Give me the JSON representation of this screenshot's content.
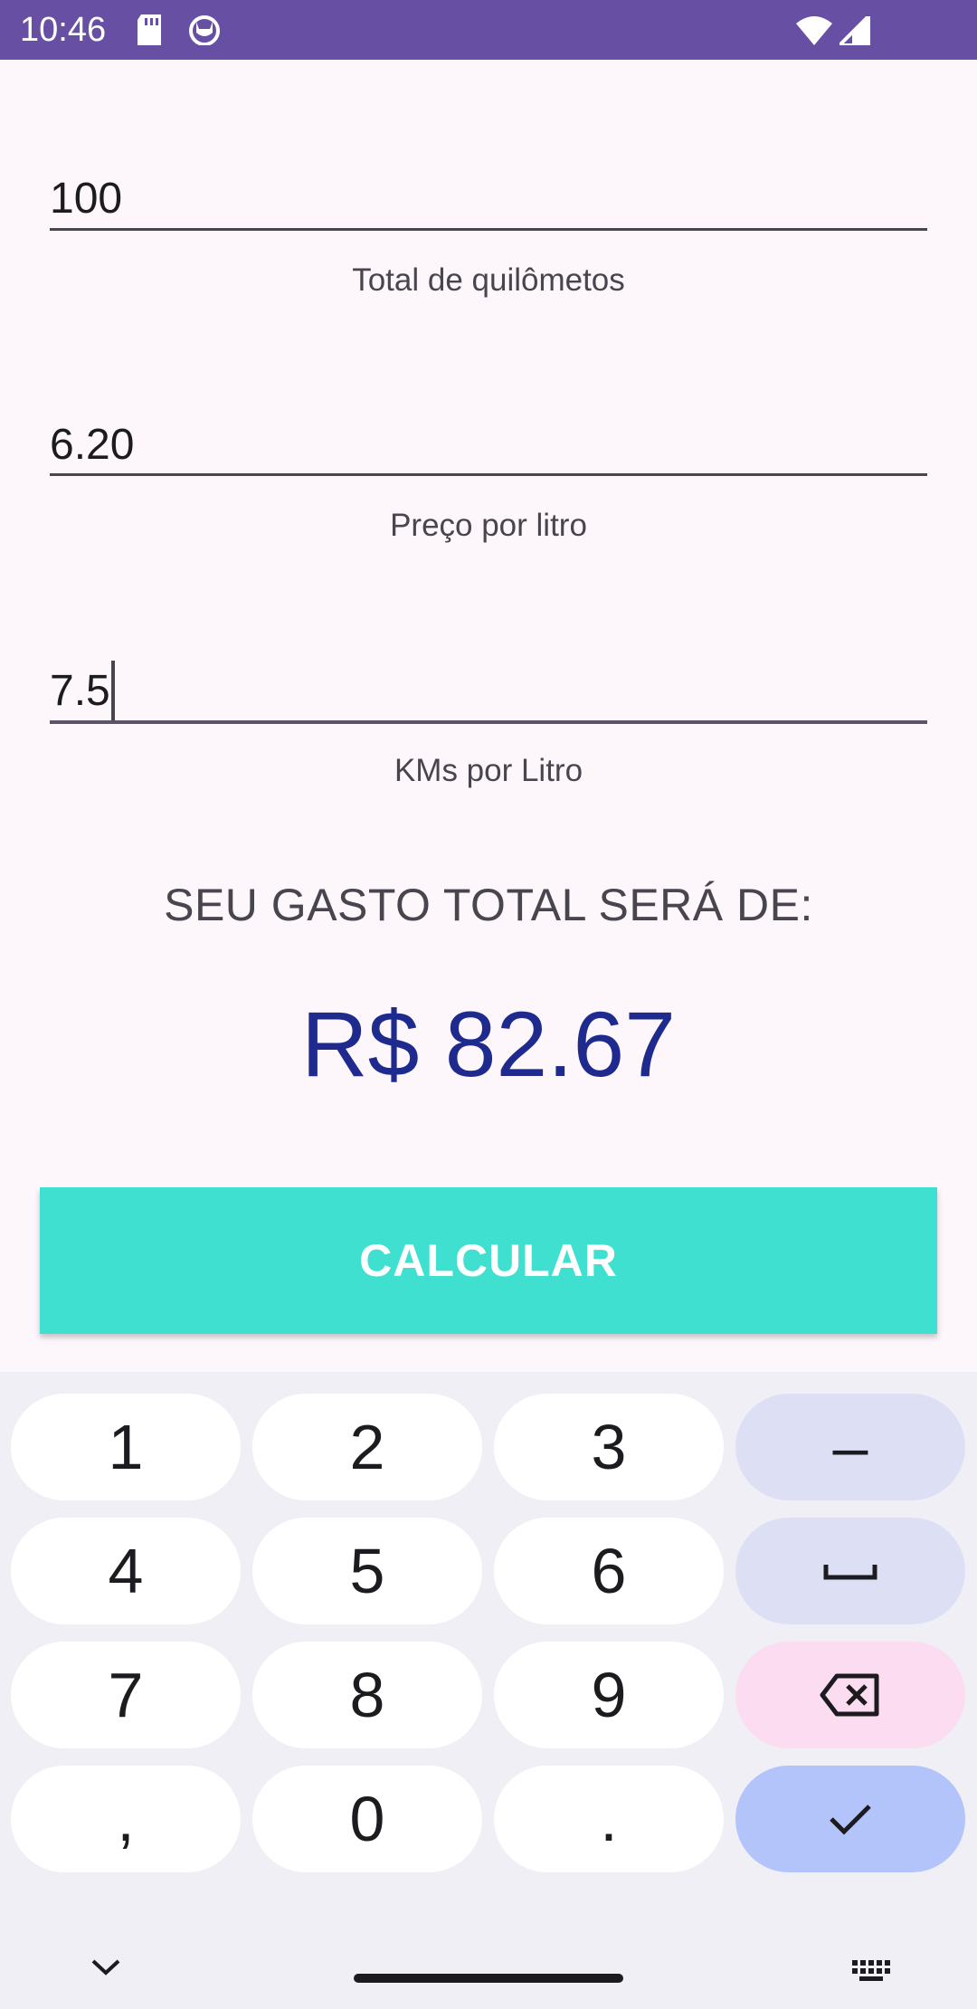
{
  "status_bar": {
    "time": "10:46",
    "icons": [
      "sd-card-icon",
      "cat-app-icon",
      "wifi-icon",
      "cell-signal-icon"
    ],
    "color": "#6750a4"
  },
  "form": {
    "fields": [
      {
        "value": "100",
        "label": "Total de quilômetos"
      },
      {
        "value": "6.20",
        "label": "Preço por litro"
      },
      {
        "value": "7.5",
        "label": "KMs por Litro"
      }
    ]
  },
  "result": {
    "title": "SEU GASTO TOTAL SERÁ DE:",
    "value": "R$ 82.67",
    "value_color": "#1f2a8f"
  },
  "button": {
    "label": "CALCULAR",
    "color": "#40e0d0"
  },
  "keyboard": {
    "keys": [
      "1",
      "2",
      "3",
      "–",
      "4",
      "5",
      "6",
      "␣",
      "7",
      "8",
      "9",
      "⌫",
      ",",
      "0",
      ".",
      "✓"
    ],
    "icons": [
      "space-icon",
      "backspace-icon",
      "check-icon",
      "chevron-down-icon",
      "keyboard-icon"
    ]
  }
}
